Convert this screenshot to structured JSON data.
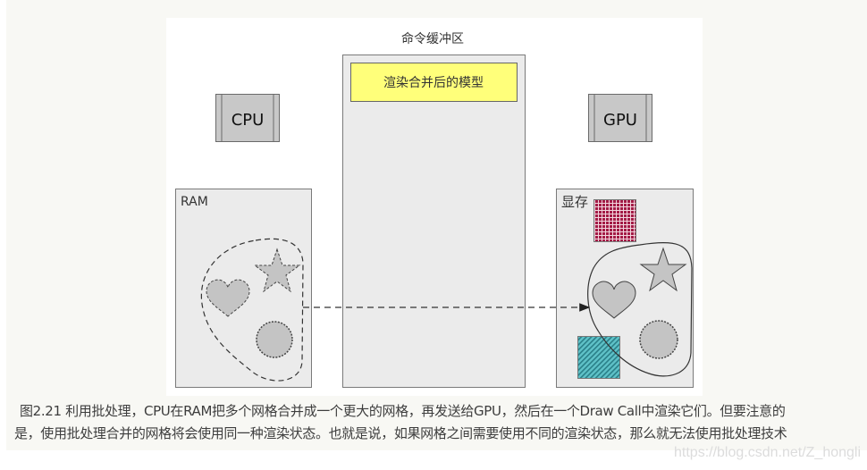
{
  "figure": {
    "command_buffer_title": "命令缓冲区",
    "command_buffer_item": "渲染合并后的模型",
    "cpu_label": "CPU",
    "gpu_label": "GPU",
    "ram_label": "RAM",
    "vram_label": "显存",
    "colors": {
      "panel_fill": "#ebebeb",
      "panel_border": "#7a7a7a",
      "chip_fill": "#c8c8c8",
      "item_fill": "#ffff7a",
      "shape_fill": "#c4c4c4",
      "checker_color": "#a31a45",
      "stripe_color": "#3a9fa8"
    }
  },
  "caption": {
    "line1": "图2.21 利用批处理，CPU在RAM把多个网格合并成一个更大的网格，再发送给GPU，然后在一个Draw Call中渲染它们。但要注意的",
    "line2": "是，使用批处理合并的网格将会使用同一种渲染状态。也就是说，如果网格之间需要使用不同的渲染状态，那么就无法使用批处理技术"
  },
  "watermark": "https://blog.csdn.net/Z_hongli"
}
